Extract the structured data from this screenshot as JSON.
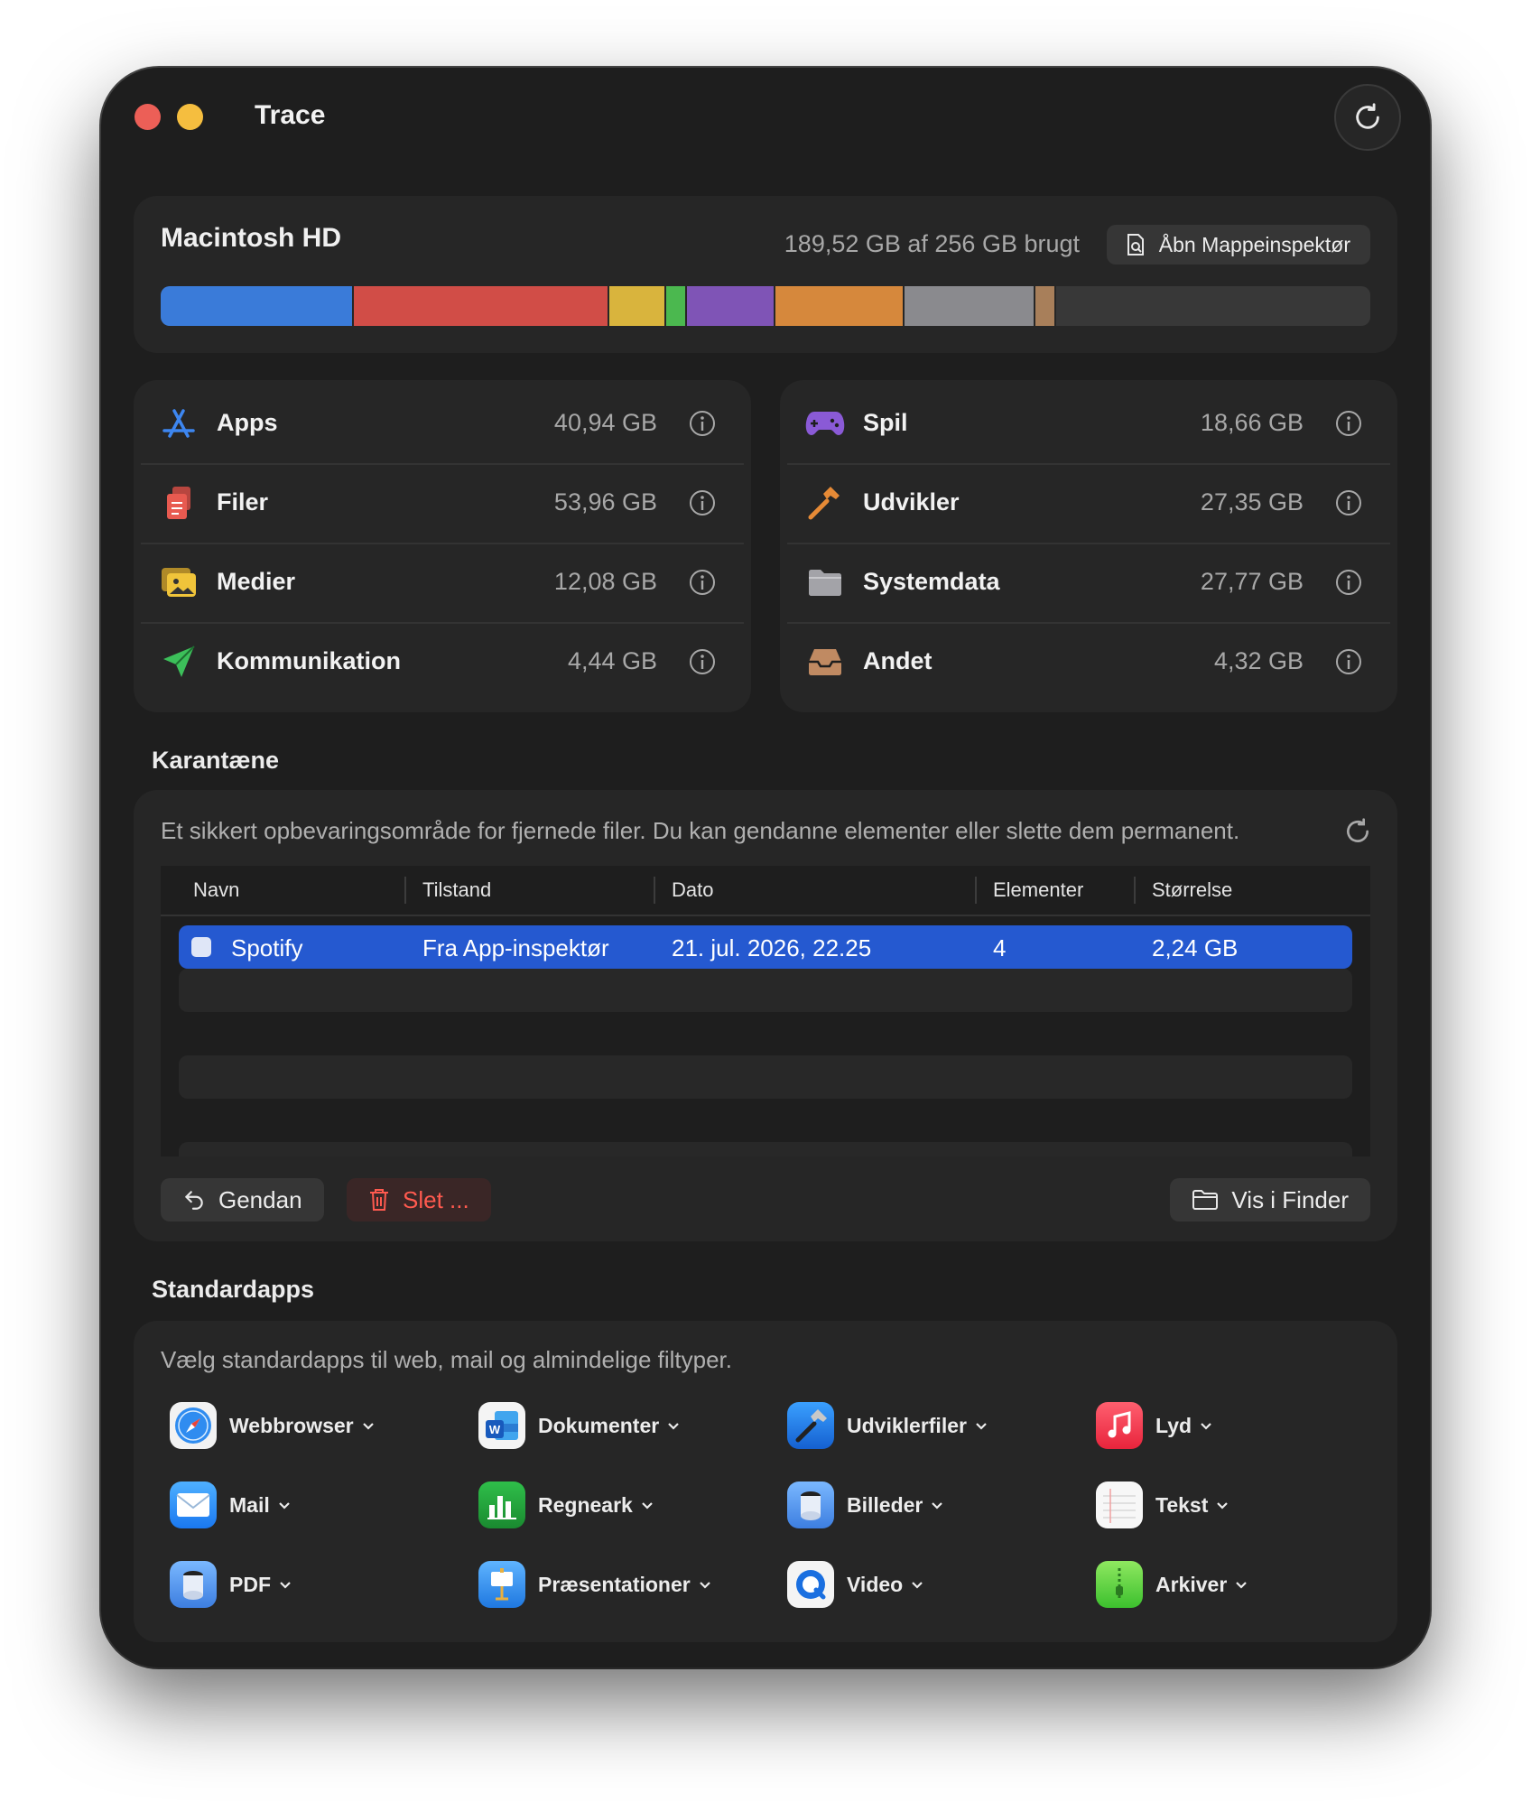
{
  "window": {
    "title": "Trace"
  },
  "disk": {
    "name": "Macintosh HD",
    "usage_text": "189,52 GB af 256 GB brugt",
    "inspector_button": "Åbn Mappeinspektør",
    "total_gb": 256,
    "used_gb": 189.52,
    "segments": [
      {
        "name": "Apps",
        "gb": 40.94,
        "color": "#3a7bd9"
      },
      {
        "name": "Filer",
        "gb": 53.96,
        "color": "#d14d47"
      },
      {
        "name": "Medier",
        "gb": 12.08,
        "color": "#d9b43d"
      },
      {
        "name": "Kommunikation",
        "gb": 4.44,
        "color": "#4bb84f"
      },
      {
        "name": "Spil",
        "gb": 18.66,
        "color": "#7f54b6"
      },
      {
        "name": "Udvikler",
        "gb": 27.35,
        "color": "#d6883c"
      },
      {
        "name": "Systemdata",
        "gb": 27.77,
        "color": "#8a8a8e"
      },
      {
        "name": "Andet",
        "gb": 4.32,
        "color": "#a87f5a"
      }
    ]
  },
  "categories": {
    "left": [
      {
        "label": "Apps",
        "size": "40,94 GB",
        "icon": "app-store-icon"
      },
      {
        "label": "Filer",
        "size": "53,96 GB",
        "icon": "documents-icon"
      },
      {
        "label": "Medier",
        "size": "12,08 GB",
        "icon": "photos-icon"
      },
      {
        "label": "Kommunikation",
        "size": "4,44 GB",
        "icon": "paper-plane-icon"
      }
    ],
    "right": [
      {
        "label": "Spil",
        "size": "18,66 GB",
        "icon": "gamepad-icon"
      },
      {
        "label": "Udvikler",
        "size": "27,35 GB",
        "icon": "hammer-icon"
      },
      {
        "label": "Systemdata",
        "size": "27,77 GB",
        "icon": "folder-icon"
      },
      {
        "label": "Andet",
        "size": "4,32 GB",
        "icon": "tray-icon"
      }
    ]
  },
  "quarantine": {
    "title": "Karantæne",
    "description": "Et sikkert opbevaringsområde for fjernede filer. Du kan gendanne elementer eller slette dem permanent.",
    "columns": [
      "Navn",
      "Tilstand",
      "Dato",
      "Elementer",
      "Størrelse"
    ],
    "rows": [
      {
        "name": "Spotify",
        "state": "Fra App-inspektør",
        "date": "21. jul. 2026, 22.25",
        "items": "4",
        "size": "2,24 GB",
        "selected": true
      }
    ],
    "restore_button": "Gendan",
    "delete_button": "Slet ...",
    "finder_button": "Vis i Finder"
  },
  "standard_apps": {
    "title": "Standardapps",
    "description": "Vælg standardapps til web, mail og almindelige filtyper.",
    "items": [
      {
        "label": "Webbrowser",
        "icon": "safari-icon"
      },
      {
        "label": "Dokumenter",
        "icon": "word-icon"
      },
      {
        "label": "Udviklerfiler",
        "icon": "xcode-icon"
      },
      {
        "label": "Lyd",
        "icon": "music-icon"
      },
      {
        "label": "Mail",
        "icon": "mail-icon"
      },
      {
        "label": "Regneark",
        "icon": "numbers-icon"
      },
      {
        "label": "Billeder",
        "icon": "preview-icon"
      },
      {
        "label": "Tekst",
        "icon": "textedit-icon"
      },
      {
        "label": "PDF",
        "icon": "preview-icon"
      },
      {
        "label": "Præsentationer",
        "icon": "keynote-icon"
      },
      {
        "label": "Video",
        "icon": "quicktime-icon"
      },
      {
        "label": "Arkiver",
        "icon": "archive-utility-icon"
      }
    ]
  }
}
